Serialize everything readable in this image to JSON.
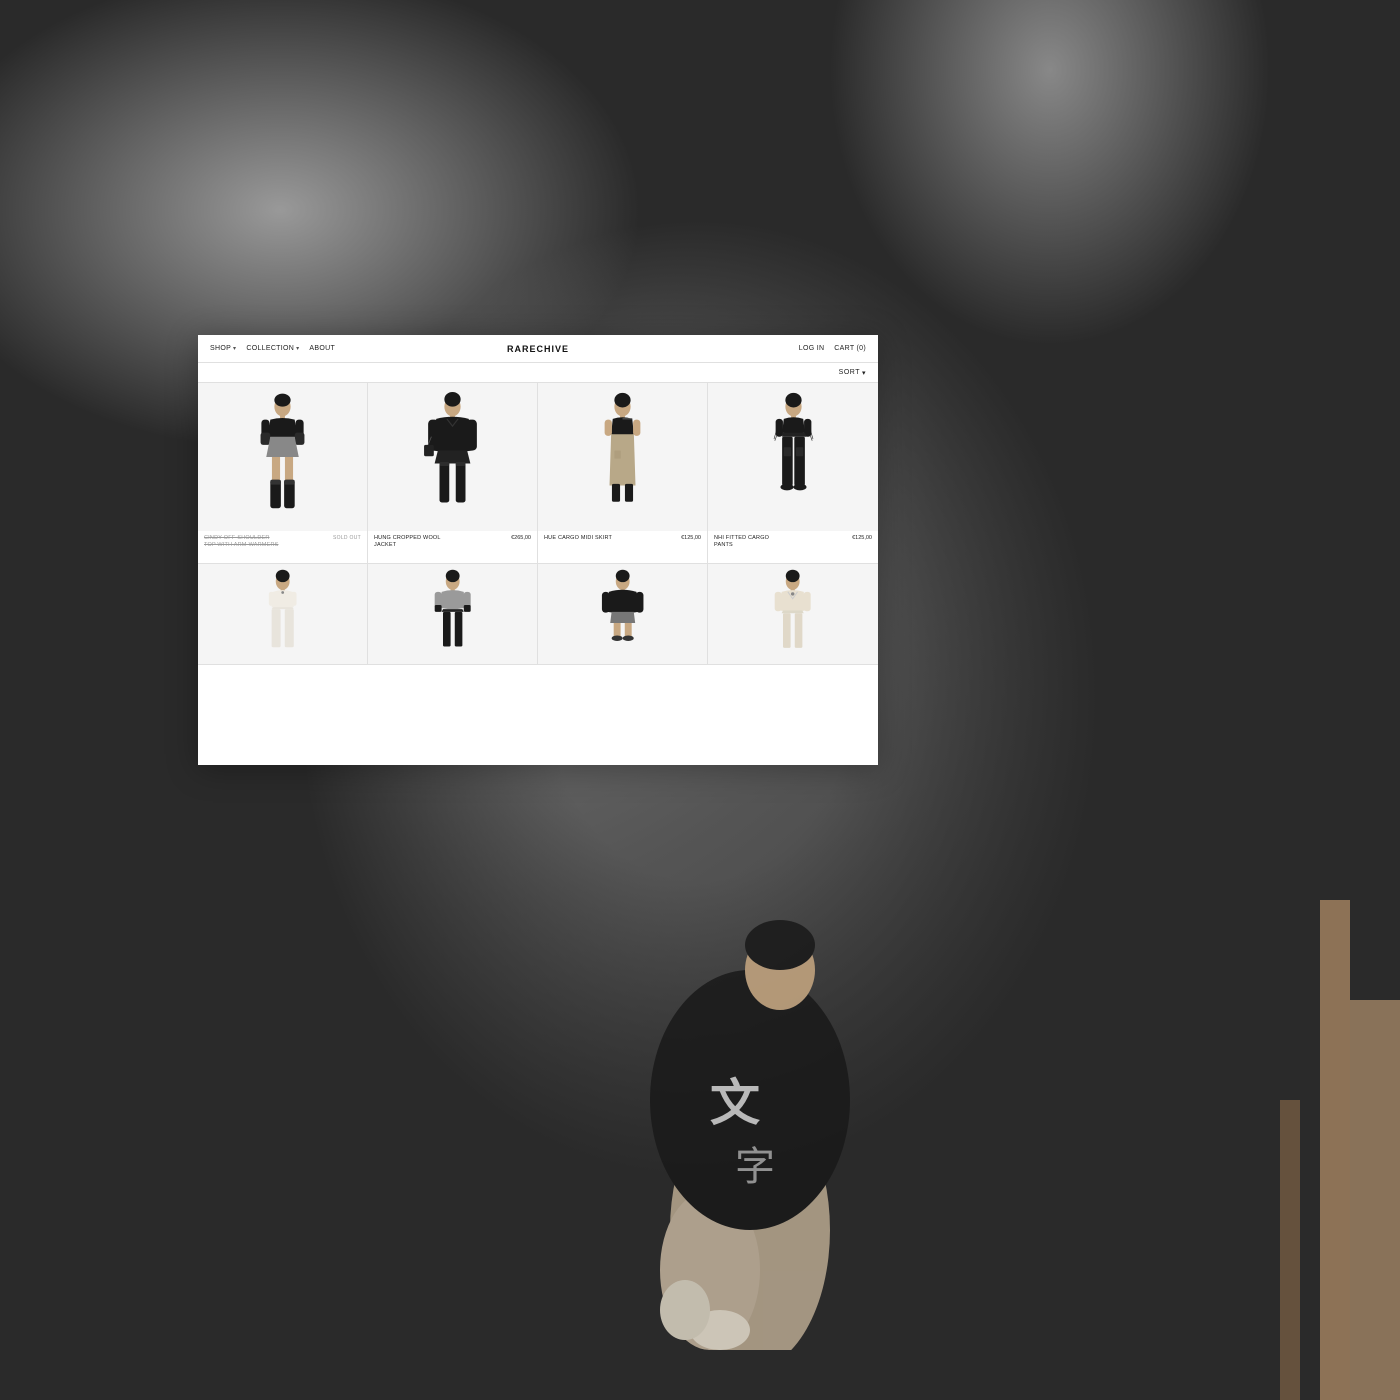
{
  "background": {
    "colors": {
      "main": "#6b6b6b",
      "dark": "#3a3a3a"
    }
  },
  "nav": {
    "brand": "RARECHIVE",
    "items": [
      {
        "label": "SHOP",
        "hasDropdown": true
      },
      {
        "label": "COLLECTION",
        "hasDropdown": true
      },
      {
        "label": "ABOUT",
        "hasDropdown": false
      }
    ],
    "right_items": [
      {
        "label": "LOG IN"
      },
      {
        "label": "CART (0)"
      }
    ]
  },
  "sort": {
    "label": "SORT",
    "has_dropdown": true
  },
  "products": [
    {
      "id": 1,
      "name": "CINDY OFF-SHOULDER TOP WITH ARM-WARMERS",
      "price": null,
      "sold_out": true,
      "row": 1,
      "col": 1,
      "figure_color": "#111",
      "outfit": "black_top_shorts_boots"
    },
    {
      "id": 2,
      "name": "HUNG CROPPED WOOL JACKET",
      "price": "€265,00",
      "sold_out": false,
      "row": 1,
      "col": 2,
      "figure_color": "#111",
      "outfit": "black_jacket_boots"
    },
    {
      "id": 3,
      "name": "HUE CARGO MIDI SKIRT",
      "price": "€125,00",
      "sold_out": false,
      "row": 1,
      "col": 3,
      "figure_color": "#111",
      "outfit": "black_top_beige_skirt"
    },
    {
      "id": 4,
      "name": "NHI FITTED CARGO PANTS",
      "price": "€125,00",
      "sold_out": false,
      "row": 1,
      "col": 4,
      "figure_color": "#111",
      "outfit": "black_top_pants"
    },
    {
      "id": 5,
      "name": "",
      "price": null,
      "sold_out": false,
      "row": 2,
      "col": 1,
      "figure_color": "#fff",
      "outfit": "white_outfit"
    },
    {
      "id": 6,
      "name": "",
      "price": null,
      "sold_out": false,
      "row": 2,
      "col": 2,
      "figure_color": "#888",
      "outfit": "grey_top_black_pants"
    },
    {
      "id": 7,
      "name": "",
      "price": null,
      "sold_out": false,
      "row": 2,
      "col": 3,
      "figure_color": "#111",
      "outfit": "black_jacket_shorts"
    },
    {
      "id": 8,
      "name": "",
      "price": null,
      "sold_out": false,
      "row": 2,
      "col": 4,
      "figure_color": "#ddd",
      "outfit": "cream_outfit"
    }
  ]
}
